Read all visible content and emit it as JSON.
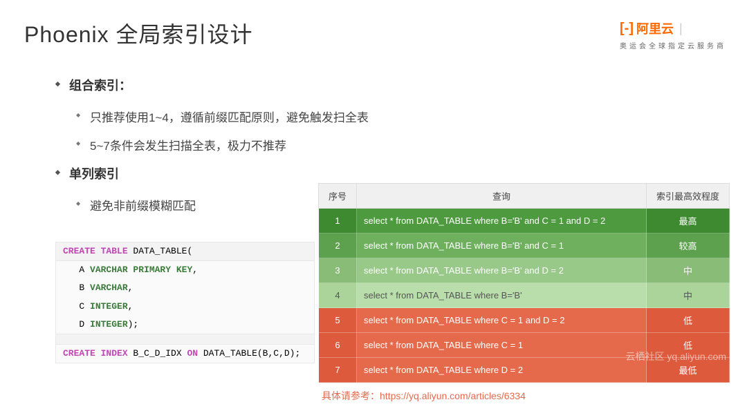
{
  "title": "Phoenix 全局索引设计",
  "logo": {
    "brand": "阿里云",
    "tagline": "奥运会全球指定云服务商"
  },
  "bullets": {
    "b1": "组合索引：",
    "b1a": "只推荐使用1~4，遵循前缀匹配原则，避免触发扫全表",
    "b1b": "5~7条件会发生扫描全表，极力不推荐",
    "b2": "单列索引",
    "b2a": "避免非前缀模糊匹配"
  },
  "code": {
    "l1_a": "CREATE TABLE",
    "l1_b": " DATA_TABLE(",
    "l2_a": "   A ",
    "l2_b": "VARCHAR PRIMARY KEY",
    "l2_c": ",",
    "l3_a": "   B ",
    "l3_b": "VARCHAR",
    "l3_c": ",",
    "l4_a": "   C ",
    "l4_b": "INTEGER",
    "l4_c": ",",
    "l5_a": "   D ",
    "l5_b": "INTEGER",
    "l5_c": ");",
    "l7_a": "CREATE INDEX",
    "l7_b": " B_C_D_IDX ",
    "l7_c": "ON",
    "l7_d": " DATA_TABLE(B,C,D);"
  },
  "table": {
    "headers": {
      "seq": "序号",
      "query": "查询",
      "eff": "索引最高效程度"
    },
    "rows": [
      {
        "seq": "1",
        "query": "select * from DATA_TABLE where B='B' and C = 1 and D = 2",
        "eff": "最高"
      },
      {
        "seq": "2",
        "query": "select * from DATA_TABLE where B='B' and C = 1",
        "eff": "较高"
      },
      {
        "seq": "3",
        "query": "select * from DATA_TABLE where B='B' and D = 2",
        "eff": "中"
      },
      {
        "seq": "4",
        "query": "select * from DATA_TABLE where B='B'",
        "eff": "中"
      },
      {
        "seq": "5",
        "query": "select * from DATA_TABLE where C = 1 and D = 2",
        "eff": "低"
      },
      {
        "seq": "6",
        "query": "select * from DATA_TABLE where C = 1",
        "eff": "低"
      },
      {
        "seq": "7",
        "query": "select * from DATA_TABLE where D = 2",
        "eff": "最低"
      }
    ]
  },
  "reference": "具体请参考：https://yq.aliyun.com/articles/6334",
  "watermark": "云栖社区  yq.aliyun.com"
}
